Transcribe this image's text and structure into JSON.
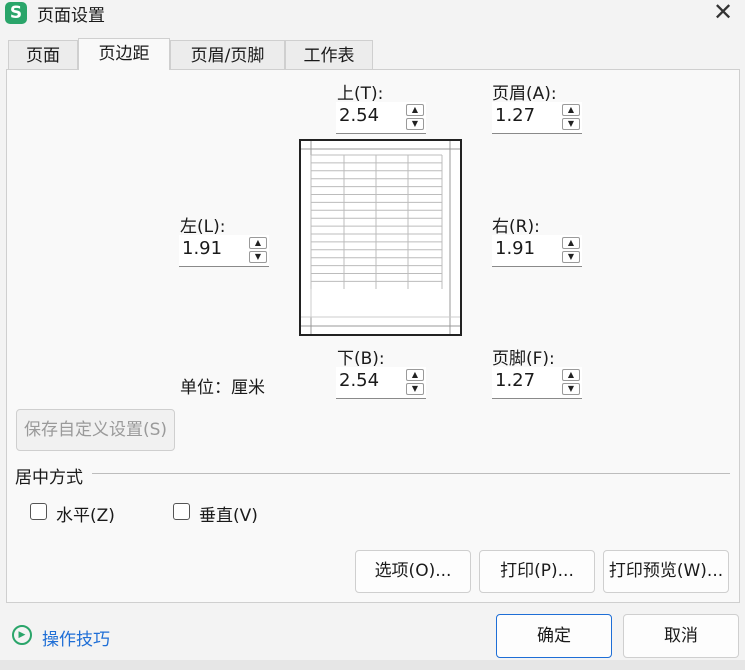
{
  "window": {
    "title": "页面设置",
    "app_icon_letter": "S",
    "close_glyph": "✕"
  },
  "tabs": [
    {
      "label": "页面",
      "active": false
    },
    {
      "label": "页边距",
      "active": true
    },
    {
      "label": "页眉/页脚",
      "active": false
    },
    {
      "label": "工作表",
      "active": false
    }
  ],
  "margins": {
    "top": {
      "label": "上(T):",
      "value": "2.54"
    },
    "header": {
      "label": "页眉(A):",
      "value": "1.27"
    },
    "left": {
      "label": "左(L):",
      "value": "1.91"
    },
    "right": {
      "label": "右(R):",
      "value": "1.91"
    },
    "bottom": {
      "label": "下(B):",
      "value": "2.54"
    },
    "footer": {
      "label": "页脚(F):",
      "value": "1.27"
    }
  },
  "unit_label": "单位：厘米",
  "save_custom_button": "保存自定义设置(S)",
  "center": {
    "section_title": "居中方式",
    "horizontal_label": "水平(Z)",
    "vertical_label": "垂直(V)"
  },
  "action_buttons": {
    "options": "选项(O)...",
    "print": "打印(P)...",
    "print_preview": "打印预览(W)..."
  },
  "footer_bar": {
    "tips_label": "操作技巧",
    "ok": "确定",
    "cancel": "取消"
  },
  "colors": {
    "accent": "#1e6ed6",
    "brand": "#2aa56a",
    "tips_text": "#1e6ed6"
  }
}
